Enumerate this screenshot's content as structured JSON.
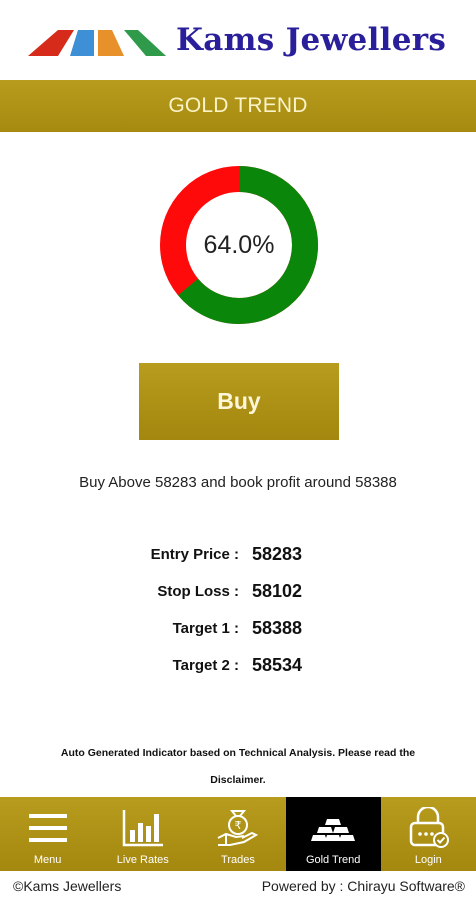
{
  "header": {
    "brand_name": "Kams Jewellers",
    "logo_colors": [
      "#d62a1a",
      "#3d8fd6",
      "#e8902a",
      "#2e9a4a"
    ]
  },
  "page": {
    "title": "GOLD TREND"
  },
  "gauge": {
    "percent_text": "64.0%",
    "percent": 64.0,
    "colors": {
      "positive": "#0a860a",
      "negative": "#ff0a0a"
    }
  },
  "signal": {
    "button_label": "Buy",
    "advice": "Buy Above 58283 and book profit around 58388"
  },
  "levels": [
    {
      "label": "Entry Price :",
      "value": "58283"
    },
    {
      "label": "Stop Loss :",
      "value": "58102"
    },
    {
      "label": "Target 1 :",
      "value": "58388"
    },
    {
      "label": "Target 2 :",
      "value": "58534"
    }
  ],
  "disclaimer": "Auto Generated Indicator based on Technical Analysis. Please read the Disclaimer.",
  "nav": [
    {
      "label": "Menu",
      "icon": "hamburger-menu-icon",
      "active": false
    },
    {
      "label": "Live Rates",
      "icon": "bar-chart-icon",
      "active": false
    },
    {
      "label": "Trades",
      "icon": "rupee-hand-icon",
      "active": false
    },
    {
      "label": "Gold Trend",
      "icon": "gold-bars-icon",
      "active": true
    },
    {
      "label": "Login",
      "icon": "lock-icon",
      "active": false
    }
  ],
  "footer": {
    "copyright": "©Kams Jewellers",
    "powered_by": "Powered by : Chirayu Software®"
  },
  "theme": {
    "gold": "#b09414",
    "brand_blue": "#2a1f9a"
  }
}
